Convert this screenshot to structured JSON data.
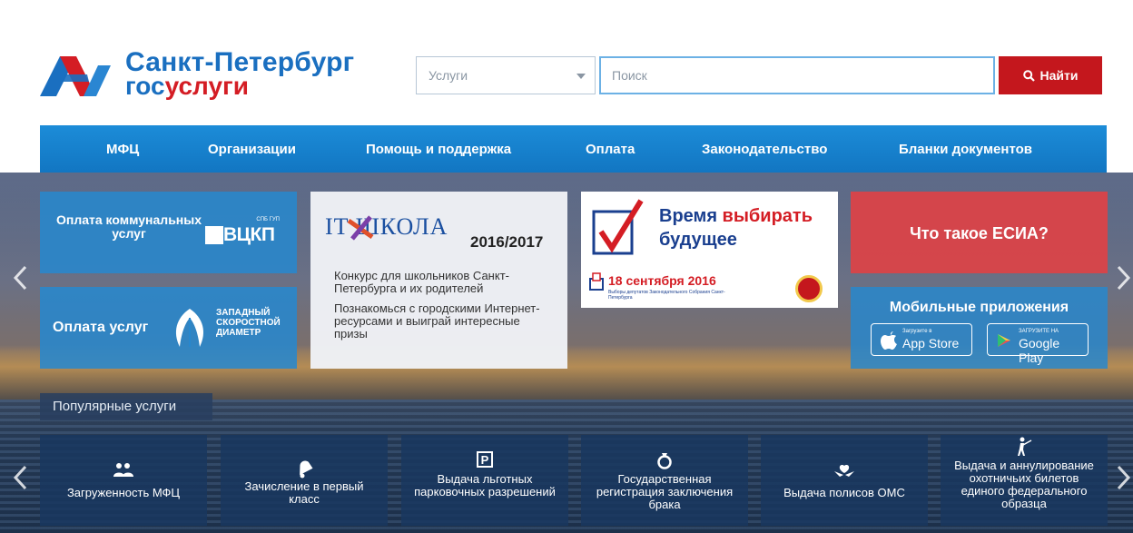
{
  "header": {
    "logo": {
      "city": "Санкт-Петербург",
      "gos": "гос",
      "uslugi": "услуги"
    },
    "search": {
      "category_value": "Услуги",
      "placeholder": "Поиск",
      "button_label": "Найти"
    }
  },
  "nav": {
    "items": [
      "МФЦ",
      "Организации",
      "Помощь и поддержка",
      "Оплата",
      "Законодательство",
      "Бланки документов"
    ]
  },
  "banners": {
    "utilities": {
      "label": "Оплата коммунальных услуг",
      "logo_text": "ВЦКП",
      "logo_sub": "СПБ ГУП"
    },
    "zsd": {
      "label": "Оплата услуг",
      "logo_text": "ЗАПАДНЫЙ СКОРОСТНОЙ ДИАМЕТР"
    },
    "it_school": {
      "logo": "IT ШКОЛА",
      "year": "2016/2017",
      "text1": "Конкурс для школьников Санкт-Петербурга и их родителей",
      "text2": "Познакомься с городскими Интернет-ресурсами и выиграй интересные призы"
    },
    "elections": {
      "title_a": "Время",
      "title_b": "выбирать",
      "title_c": "будущее",
      "date_num": "18",
      "date_rest": "сентября 2016",
      "small_text": "Выборы депутатов Законодательного Собрания Санкт-Петербурга"
    },
    "esia": {
      "label": "Что такое ЕСИА?"
    },
    "apps": {
      "title": "Мобильные приложения",
      "apple_small": "Загрузите в",
      "apple_big": "App Store",
      "google_small": "ЗАГРУЗИТЕ НА",
      "google_big": "Google Play"
    }
  },
  "popular": {
    "title": "Популярные услуги",
    "items": [
      {
        "label": "Загруженность МФЦ",
        "icon": "people-icon"
      },
      {
        "label": "Зачисление в первый класс",
        "icon": "bell-icon"
      },
      {
        "label": "Выдача льготных парковочных разрешений",
        "icon": "parking-icon"
      },
      {
        "label": "Государственная регистрация заключения брака",
        "icon": "rings-icon"
      },
      {
        "label": "Выдача полисов ОМС",
        "icon": "hands-icon"
      },
      {
        "label": "Выдача и аннулирование охотничьих билетов единого федерального образца",
        "icon": "hunter-icon"
      }
    ]
  },
  "colors": {
    "brand_blue": "#1a6fc0",
    "brand_red": "#d41d24",
    "nav_blue": "#1c8cd8",
    "button_red": "#c4171d"
  }
}
